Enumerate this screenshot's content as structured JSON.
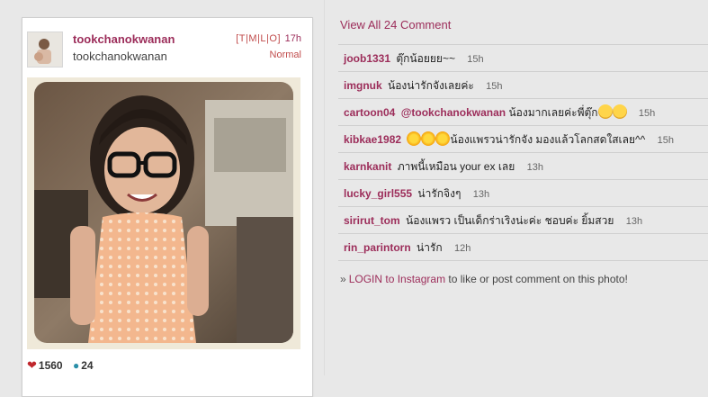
{
  "post": {
    "username": "tookchanokwanan",
    "fullname": "tookchanokwanan",
    "views": [
      "T",
      "M",
      "L",
      "O"
    ],
    "time_ago": "17h",
    "filter": "Normal",
    "likes": "1560",
    "comments_count": "24"
  },
  "comments_panel": {
    "view_all_label": "View All 24 Comment",
    "comments": [
      {
        "user": "joob1331",
        "text": "ตุ๊กน้อยยย~~",
        "time": "15h"
      },
      {
        "user": "imgnuk",
        "text": "น้องน่ารักจังเลยค่ะ",
        "time": "15h"
      },
      {
        "user": "cartoon04",
        "mention": "@tookchanokwanan",
        "text": "น้องมากเลยค่ะพี่ตุ๊ก",
        "time": "15h"
      },
      {
        "user": "kibkae1982",
        "text": "น้องแพรวน่ารักจัง มองแล้วโลกสดใสเลย^^",
        "time": "15h"
      },
      {
        "user": "karnkanit",
        "text": "ภาพนี้เหมือน your ex เลย",
        "time": "13h"
      },
      {
        "user": "lucky_girl555",
        "text": "น่ารักจิงๆ",
        "time": "13h"
      },
      {
        "user": "sirirut_tom",
        "text": "น้องแพรว เป็นเด็กร่าเริงน่ะค่ะ ชอบค่ะ ยิ้มสวย",
        "time": "13h"
      },
      {
        "user": "rin_parintorn",
        "text": "น่ารัก",
        "time": "12h"
      }
    ],
    "login_prefix": "»",
    "login_link": "LOGIN to Instagram",
    "login_suffix": " to like or post comment on this photo!"
  },
  "icons": {
    "heart": "heart-icon",
    "comment": "comment-bubble-icon",
    "sun": "sun-emoji-icon",
    "face": "face-emoji-icon"
  },
  "colors": {
    "link": "#9c2d5a",
    "heart": "#c0272d",
    "bubble": "#2a8fa8",
    "background": "#e8e8e8"
  }
}
